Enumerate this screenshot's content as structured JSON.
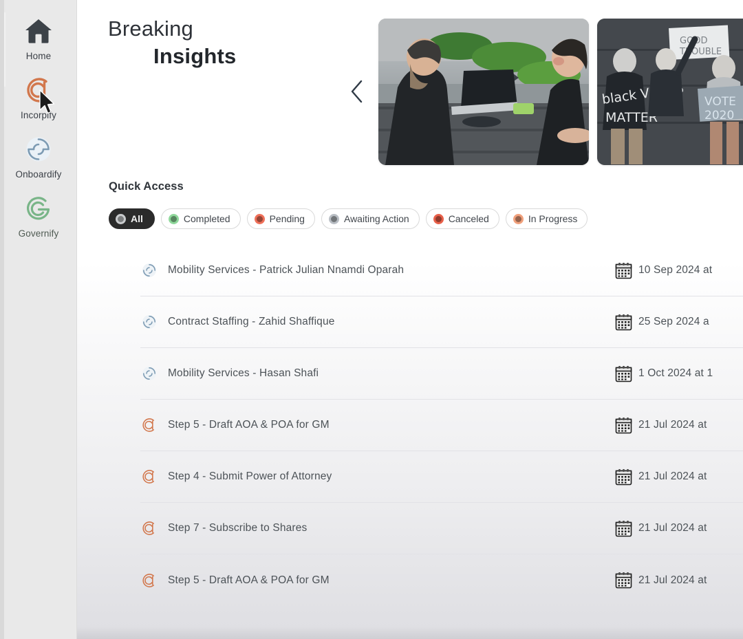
{
  "sidebar": {
    "items": [
      {
        "label": "Home",
        "icon": "home-icon",
        "color": "#3c4248"
      },
      {
        "label": "Incorpify",
        "icon": "incorpify-logo-icon",
        "color": "#d2774c"
      },
      {
        "label": "Onboardify",
        "icon": "onboardify-logo-icon",
        "color": "#7d9bb3"
      },
      {
        "label": "Governify",
        "icon": "governify-logo-icon",
        "color": "#79b588"
      }
    ]
  },
  "hero": {
    "title_line1": "Breaking",
    "title_line2": "Insights",
    "prev_arrow": "chevron-left-icon",
    "slides": [
      {
        "alt": "Two business people meeting at an outdoor table with a laptop"
      },
      {
        "alt": "Protesters holding Black Votes Matter and Vote 2020 signs"
      }
    ]
  },
  "quick_access": {
    "title": "Quick Access",
    "chips": [
      {
        "label": "All",
        "color": "#c9cbcd",
        "active": true
      },
      {
        "label": "Completed",
        "color": "#8fd89b",
        "active": false
      },
      {
        "label": "Pending",
        "color": "#ef7059",
        "active": false
      },
      {
        "label": "Awaiting Action",
        "color": "#b9bec4",
        "active": false
      },
      {
        "label": "Canceled",
        "color": "#e8604a",
        "active": false
      },
      {
        "label": "In Progress",
        "color": "#f0a07c",
        "active": false
      }
    ],
    "rows": [
      {
        "icon": "onboardify-logo-icon",
        "label": "Mobility Services - Patrick Julian Nnamdi Oparah",
        "date": "10 Sep 2024 at"
      },
      {
        "icon": "onboardify-logo-icon",
        "label": "Contract Staffing - Zahid Shaffique",
        "date": "25 Sep 2024 a"
      },
      {
        "icon": "onboardify-logo-icon",
        "label": "Mobility Services - Hasan Shafi",
        "date": "1 Oct 2024 at 1"
      },
      {
        "icon": "incorpify-logo-icon",
        "label": "Step 5 - Draft AOA & POA for GM",
        "date": "21 Jul 2024 at"
      },
      {
        "icon": "incorpify-logo-icon",
        "label": "Step 4 - Submit Power of Attorney",
        "date": "21 Jul 2024 at"
      },
      {
        "icon": "incorpify-logo-icon",
        "label": "Step 7 - Subscribe to Shares",
        "date": "21 Jul 2024 at"
      },
      {
        "icon": "incorpify-logo-icon",
        "label": "Step 5 - Draft AOA & POA for GM",
        "date": "21 Jul 2024 at"
      }
    ],
    "calendar_icon": "calendar-icon"
  }
}
